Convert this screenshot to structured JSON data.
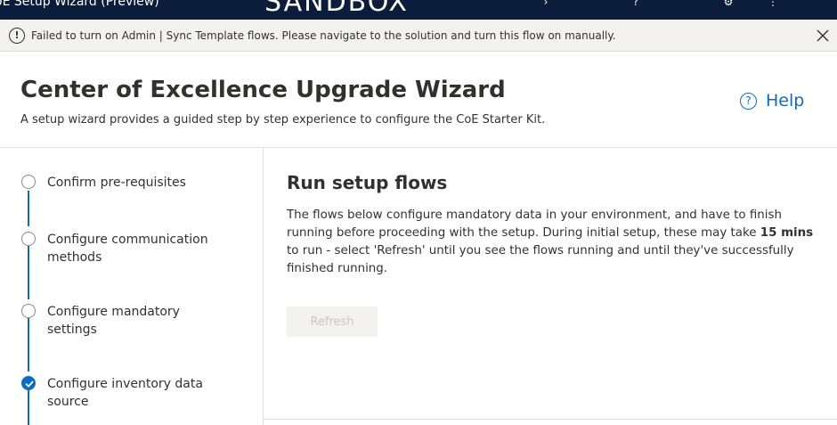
{
  "top_bar": {
    "app_title": "oE Setup Wizard (Preview)",
    "environment_name": "SANDBOX",
    "icons": [
      "chevron-right-icon",
      "question-icon",
      "settings-icon",
      "more-icon"
    ],
    "background_color": "#0b1d3a"
  },
  "notification": {
    "icon": "info-icon",
    "message": "Failed to turn on Admin | Sync Template flows. Please navigate to the solution and turn this flow on manually.",
    "close_icon": "close-icon"
  },
  "header": {
    "title": "Center of Excellence Upgrade Wizard",
    "subtitle": "A setup wizard provides a guided step by step experience to configure the CoE Starter Kit.",
    "help_label": "Help",
    "help_icon": "help-circle-icon",
    "accent_color": "#0f6cbd"
  },
  "steps": [
    {
      "label": "Confirm pre-requisites",
      "status": "not-started"
    },
    {
      "label": "Configure communication methods",
      "status": "not-started"
    },
    {
      "label": "Configure mandatory settings",
      "status": "not-started"
    },
    {
      "label": "Configure inventory data source",
      "status": "completed"
    }
  ],
  "content": {
    "title": "Run setup flows",
    "body_before_bold": "The flows below configure mandatory data in your environment, and have to finish running before proceeding with the setup. During initial setup, these may take ",
    "body_bold": "15 mins",
    "body_after_bold": " to run - select 'Refresh' until you see the flows running and until they've successfully finished running.",
    "refresh_label": "Refresh",
    "refresh_disabled": true
  }
}
